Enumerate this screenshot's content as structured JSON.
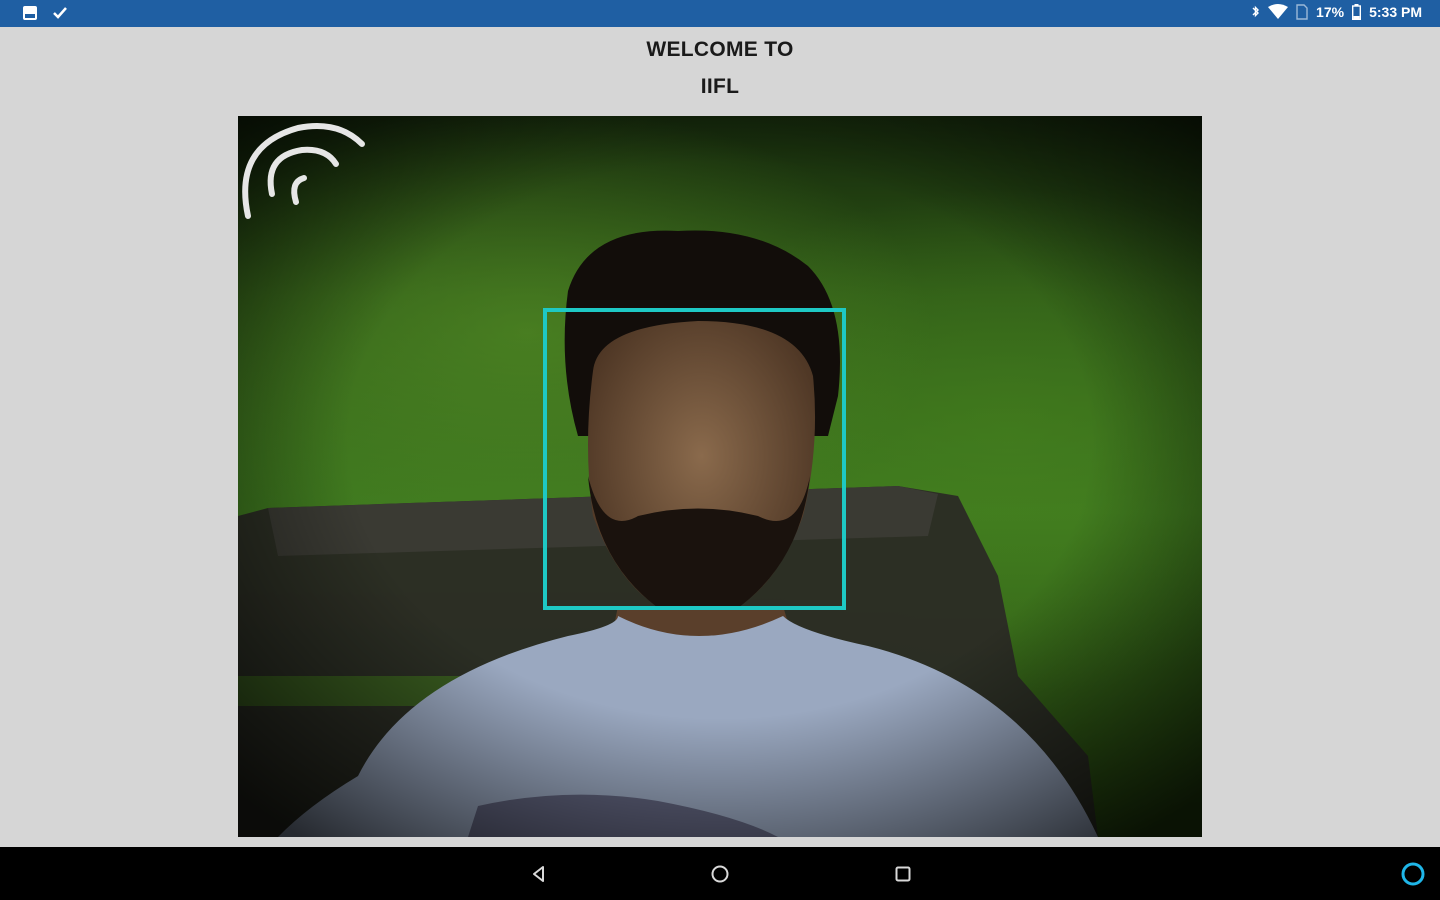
{
  "status_bar": {
    "battery_percent": "17%",
    "time": "5:33 PM",
    "left_icons": [
      "gallery-icon",
      "check-icon"
    ],
    "right_icons": [
      "bluetooth-icon",
      "wifi-icon",
      "sim-icon",
      "battery-icon"
    ]
  },
  "header": {
    "title_line_1": "WELCOME TO",
    "title_line_2": "IIFL"
  },
  "camera": {
    "face_frame_color": "#1ec8c4",
    "overlay_icon": "face-scan-icon"
  },
  "nav_bar": {
    "buttons": [
      "back-icon",
      "home-icon",
      "recent-apps-icon"
    ],
    "assistant": "assistant-icon"
  },
  "colors": {
    "status_bar": "#1f5fa3",
    "background": "#d6d6d6",
    "nav_bar": "#000000"
  }
}
